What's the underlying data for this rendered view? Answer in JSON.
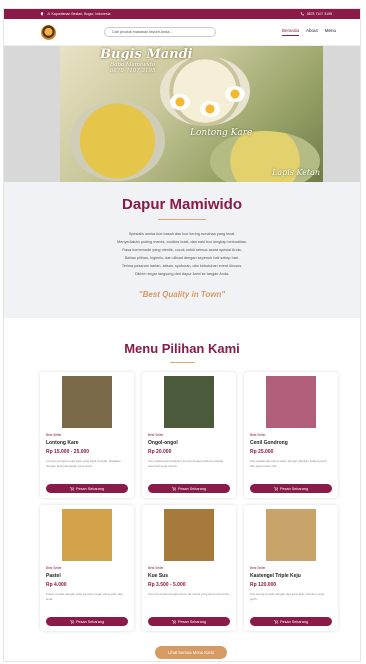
{
  "topbar": {
    "address": "Jl. Kapuntenan Bestari, Bogor, Indonesia",
    "phone": "0878 7107 3195"
  },
  "nav": {
    "search_placeholder": "Cari produk makanan favorit Anda...",
    "items": [
      {
        "label": "Beranda",
        "active": true
      },
      {
        "label": "About",
        "active": false
      },
      {
        "label": "Menu",
        "active": false
      }
    ]
  },
  "hero": {
    "brand": "Bugis Mandi",
    "brand_sub": "Bapa Mamiwido",
    "brand_phone": "0878 7107 3195",
    "label_1": "Lontong Kare",
    "label_2": "Lapis Ketan"
  },
  "about": {
    "title": "Dapur Mamiwido",
    "lines": [
      "Spesialis aneka kue basah dan kue kering rumahan yang lezat.",
      "Menyediakan puding mamiz, cookies lezat, dan nasi box lengkap berkualitas.",
      "Rasa homemade yang otentik, cocok untuk semua acara spesial Anda.",
      "Bahan pilihan, higienis, dan dibuat dengan sepenuh hati setiap hari.",
      "Terima pesanan harian, arisan, syukuran, dan kebutuhan event khusus.",
      "Dikirim segar langsung dari dapur kami ke tangan Anda."
    ],
    "tagline": "\"Best Quality in Town\""
  },
  "menu_section": {
    "title": "Menu Pilihan Kami",
    "button_label": "Pesan Sekarang",
    "view_all": "Lihat Semua Menu Kami"
  },
  "products": [
    {
      "badge": "Best Seller",
      "name": "Lontong Kare",
      "price": "Rp 15.000 - 25.000",
      "desc": "Lontong dengan kuah kare yang kaya rempah, disajikan dengan lauk pelengkap yang lezat.",
      "thumb_color": "#7a6a4a"
    },
    {
      "badge": "Best Seller",
      "name": "Ongol-ongol",
      "price": "Rp 20.000",
      "desc": "Kue tradisional bertekstur kenyal dengan taburan kelapa parut dan gula merah.",
      "thumb_color": "#4a5a3a"
    },
    {
      "badge": "Best Seller",
      "name": "Cenil Gondrong",
      "price": "Rp 25.000",
      "desc": "Kue tradisional warna-warni dengan taburan kelapa parut dan gula merah cair.",
      "thumb_color": "#b0607a"
    },
    {
      "badge": "Best Seller",
      "name": "Pastel",
      "price": "Rp 4.000",
      "desc": "Pastel renyah dengan isian sayuran segar yang gurih dan lezat.",
      "thumb_color": "#d2a24a"
    },
    {
      "badge": "Best Seller",
      "name": "Kue Sus",
      "price": "Rp 3.500 - 5.000",
      "desc": "Kue sus lembut dengan isian vla manis yang lumer dan lezat.",
      "thumb_color": "#a57a3a"
    },
    {
      "badge": "Best Seller",
      "name": "Kastengel Triple Keju",
      "price": "Rp 120.000",
      "desc": "Kue kering renyah dengan tiga jenis keju premium yang gurih.",
      "thumb_color": "#c8a46a"
    }
  ]
}
